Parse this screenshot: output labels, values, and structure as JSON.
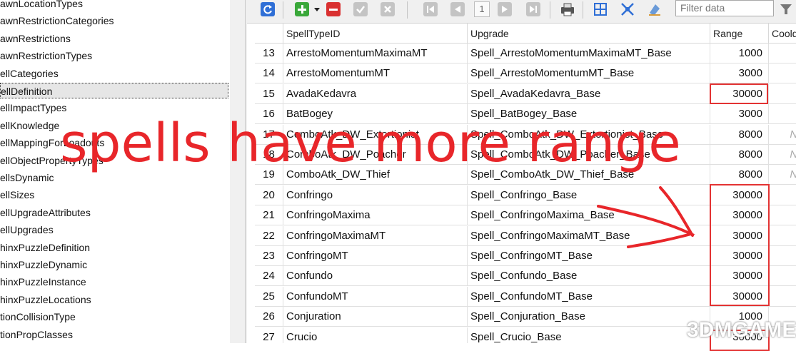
{
  "tree": {
    "items": [
      "awnLocationTypes",
      "awnRestrictionCategories",
      "awnRestrictions",
      "awnRestrictionTypes",
      "ellCategories",
      "ellDefinition",
      "ellImpactTypes",
      "ellKnowledge",
      "ellMappingForLoadouts",
      "ellObjectPropertyTypes",
      "ellsDynamic",
      "ellSizes",
      "ellUpgradeAttributes",
      "ellUpgrades",
      "hinxPuzzleDefinition",
      "hinxPuzzleDynamic",
      "hinxPuzzleInstance",
      "hinxPuzzleLocations",
      "tionCollisionType",
      "tionPropClasses"
    ],
    "selected_index": 5
  },
  "toolbar": {
    "page_number": "1",
    "filter_placeholder": "Filter data",
    "icons": [
      "refresh-icon",
      "add-icon",
      "dropdown-arrow-icon",
      "delete-icon",
      "commit-icon",
      "cancel-icon",
      "first-page-icon",
      "prev-page-icon",
      "next-page-icon",
      "last-page-icon",
      "print-icon",
      "fit-columns-icon",
      "expand-icon",
      "clear-format-icon",
      "filter-icon"
    ]
  },
  "grid": {
    "columns": [
      "SpellTypeID",
      "Upgrade",
      "Range",
      "Coold"
    ],
    "rows": [
      {
        "n": "13",
        "id": "ArrestoMomentumMaximaMT",
        "upgrade": "Spell_ArrestoMomentumMaximaMT_Base",
        "range": "1000",
        "cd": ""
      },
      {
        "n": "14",
        "id": "ArrestoMomentumMT",
        "upgrade": "Spell_ArrestoMomentumMT_Base",
        "range": "3000",
        "cd": ""
      },
      {
        "n": "15",
        "id": "AvadaKedavra",
        "upgrade": "Spell_AvadaKedavra_Base",
        "range": "30000",
        "cd": ""
      },
      {
        "n": "16",
        "id": "BatBogey",
        "upgrade": "Spell_BatBogey_Base",
        "range": "3000",
        "cd": ""
      },
      {
        "n": "17",
        "id": "ComboAtk_DW_Extortionist",
        "upgrade": "Spell_ComboAtk_DW_Extortionist_Base",
        "range": "8000",
        "cd": "NU"
      },
      {
        "n": "18",
        "id": "ComboAtk_DW_Poacher",
        "upgrade": "Spell_ComboAtk_DW_Poacher_Base",
        "range": "8000",
        "cd": "NU"
      },
      {
        "n": "19",
        "id": "ComboAtk_DW_Thief",
        "upgrade": "Spell_ComboAtk_DW_Thief_Base",
        "range": "8000",
        "cd": "NU"
      },
      {
        "n": "20",
        "id": "Confringo",
        "upgrade": "Spell_Confringo_Base",
        "range": "30000",
        "cd": ""
      },
      {
        "n": "21",
        "id": "ConfringoMaxima",
        "upgrade": "Spell_ConfringoMaxima_Base",
        "range": "30000",
        "cd": ""
      },
      {
        "n": "22",
        "id": "ConfringoMaximaMT",
        "upgrade": "Spell_ConfringoMaximaMT_Base",
        "range": "30000",
        "cd": ""
      },
      {
        "n": "23",
        "id": "ConfringoMT",
        "upgrade": "Spell_ConfringoMT_Base",
        "range": "30000",
        "cd": ""
      },
      {
        "n": "24",
        "id": "Confundo",
        "upgrade": "Spell_Confundo_Base",
        "range": "30000",
        "cd": ""
      },
      {
        "n": "25",
        "id": "ConfundoMT",
        "upgrade": "Spell_ConfundoMT_Base",
        "range": "30000",
        "cd": ""
      },
      {
        "n": "26",
        "id": "Conjuration",
        "upgrade": "Spell_Conjuration_Base",
        "range": "1000",
        "cd": ""
      },
      {
        "n": "27",
        "id": "Crucio",
        "upgrade": "Spell_Crucio_Base",
        "range": "30000",
        "cd": ""
      }
    ]
  },
  "annotation": {
    "text": "spells have more range",
    "color": "#e8262a"
  },
  "watermark": "3DMGAME"
}
